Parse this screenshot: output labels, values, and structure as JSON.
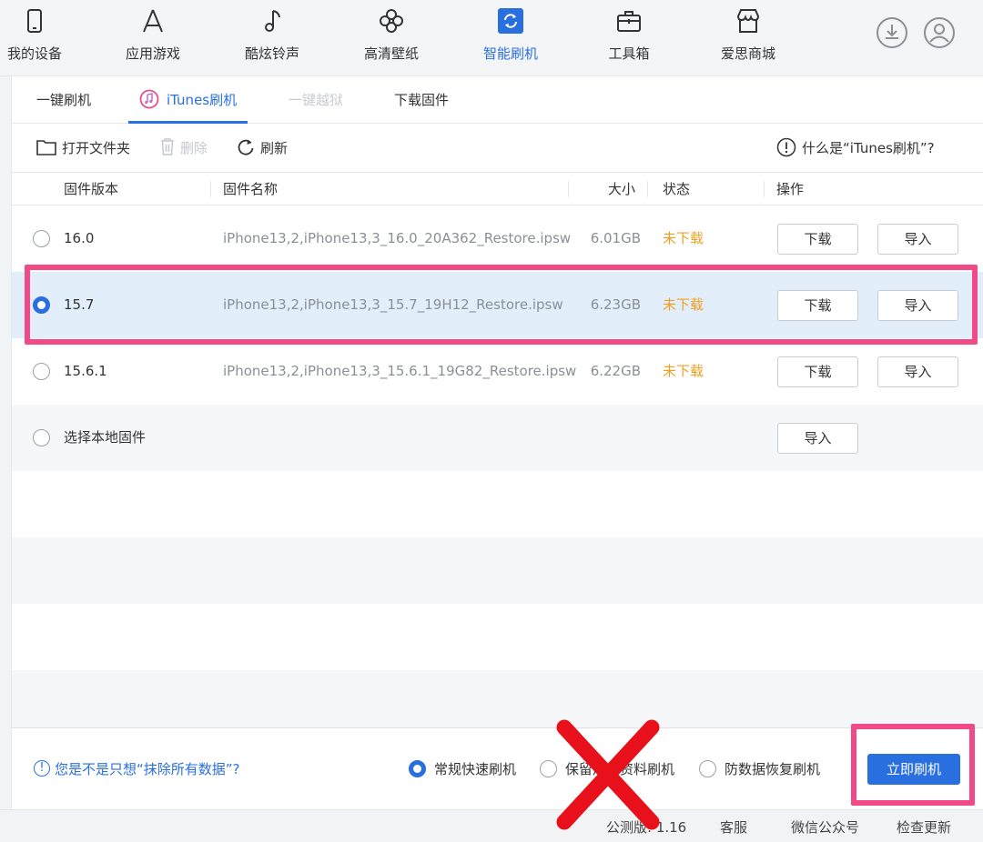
{
  "nav": {
    "items": [
      {
        "label": "我的设备",
        "icon": "phone-icon"
      },
      {
        "label": "应用游戏",
        "icon": "app-store-icon"
      },
      {
        "label": "酷炫铃声",
        "icon": "music-note-icon"
      },
      {
        "label": "高清壁纸",
        "icon": "flower-icon"
      },
      {
        "label": "智能刷机",
        "icon": "refresh-square-icon",
        "active": true
      },
      {
        "label": "工具箱",
        "icon": "toolbox-icon"
      },
      {
        "label": "爱思商城",
        "icon": "store-icon"
      }
    ],
    "download_icon": "download-circle-icon",
    "user_icon": "user-circle-icon"
  },
  "tabs": [
    {
      "label": "一键刷机"
    },
    {
      "label": "iTunes刷机",
      "active": true
    },
    {
      "label": "一键越狱",
      "disabled": true
    },
    {
      "label": "下载固件"
    }
  ],
  "toolbar": {
    "open_folder": "打开文件夹",
    "delete": "删除",
    "refresh": "刷新",
    "help": "什么是“iTunes刷机”?"
  },
  "table": {
    "headers": {
      "version": "固件版本",
      "name": "固件名称",
      "size": "大小",
      "status": "状态",
      "action": "操作"
    },
    "rows": [
      {
        "version": "16.0",
        "name": "iPhone13,2,iPhone13,3_16.0_20A362_Restore.ipsw",
        "size": "6.01GB",
        "status": "未下载",
        "download": "下载",
        "import": "导入",
        "selected": false
      },
      {
        "version": "15.7",
        "name": "iPhone13,2,iPhone13,3_15.7_19H12_Restore.ipsw",
        "size": "6.23GB",
        "status": "未下载",
        "download": "下载",
        "import": "导入",
        "selected": true
      },
      {
        "version": "15.6.1",
        "name": "iPhone13,2,iPhone13,3_15.6.1_19G82_Restore.ipsw",
        "size": "6.22GB",
        "status": "未下载",
        "download": "下载",
        "import": "导入",
        "selected": false
      }
    ],
    "local": {
      "label": "选择本地固件",
      "import": "导入"
    }
  },
  "options": {
    "wipe_question": "您是不是只想“抹除所有数据”?",
    "modes": [
      {
        "label": "常规快速刷机",
        "selected": true
      },
      {
        "label": "保留用户资料刷机",
        "selected": false
      },
      {
        "label": "防数据恢复刷机",
        "selected": false
      }
    ],
    "flash_now": "立即刷机"
  },
  "statusbar": {
    "version": "公测版: 1.16",
    "service": "客服",
    "wechat": "微信公众号",
    "check_update": "检查更新"
  },
  "colors": {
    "accent": "#2a6fe0",
    "status_orange": "#f0a020",
    "annotation_pink": "#f24a86",
    "annotation_red": "#e8101a"
  }
}
